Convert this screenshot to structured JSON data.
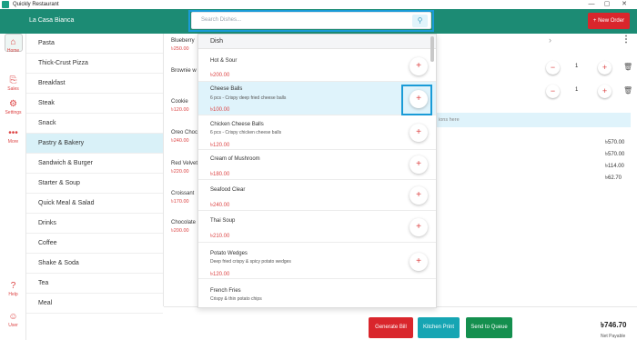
{
  "window": {
    "title": "Quickly Restaurant",
    "controls": [
      "—",
      "▢",
      "✕"
    ]
  },
  "header": {
    "store_name": "La Casa Bianca",
    "search_placeholder": "Search Dishes...",
    "new_order_label": "+ New Order"
  },
  "rail": [
    {
      "label": "Home",
      "icon": "⌂"
    },
    {
      "label": "Sales",
      "icon": "⎘"
    },
    {
      "label": "Settings",
      "icon": "⚙"
    },
    {
      "label": "More",
      "icon": "•••"
    },
    {
      "label": "Help",
      "icon": "?"
    },
    {
      "label": "User",
      "icon": "☺"
    }
  ],
  "categories": [
    "Pasta",
    "Thick-Crust Pizza",
    "Breakfast",
    "Steak",
    "Snack",
    "Pastry & Bakery",
    "Sandwich & Burger",
    "Starter & Soup",
    "Quick Meal & Salad",
    "Drinks",
    "Coffee",
    "Shake & Soda",
    "Tea",
    "Meal"
  ],
  "active_category": "Pastry & Bakery",
  "products": [
    {
      "name": "Blueberry",
      "price": "৳250.00"
    },
    {
      "name": "Brownie w",
      "price": ""
    },
    {
      "name": "Cookie",
      "price": "৳120.00"
    },
    {
      "name": "Oreo Choc",
      "price": "৳240.00"
    },
    {
      "name": "Red Velvet",
      "price": "৳220.00"
    },
    {
      "name": "Croissant",
      "price": "৳170.00"
    },
    {
      "name": "Chocolate",
      "price": "৳200.00"
    }
  ],
  "dropdown": {
    "header": "Dish",
    "items": [
      {
        "name": "Hot & Sour",
        "desc": "",
        "price": "৳200.00"
      },
      {
        "name": "Cheese Balls",
        "desc": "6 pcs - Crispy deep fried cheese balls",
        "price": "৳100.00"
      },
      {
        "name": "Chicken Cheese Balls",
        "desc": "6 pcs - Crispy chicken cheese balls",
        "price": "৳120.00"
      },
      {
        "name": "Cream of Mushroom",
        "desc": "",
        "price": "৳180.00"
      },
      {
        "name": "Seafood Clear",
        "desc": "",
        "price": "৳240.00"
      },
      {
        "name": "Thai Soup",
        "desc": "",
        "price": "৳210.00"
      },
      {
        "name": "Potato Wedges",
        "desc": "Deep fried crispy & spicy potato wedges",
        "price": "৳120.00"
      },
      {
        "name": "French Fries",
        "desc": "Crispy & thin potato chips",
        "price": ""
      }
    ],
    "add_glyph": "+"
  },
  "order": {
    "lines": [
      {
        "qty": "1"
      },
      {
        "qty": "1"
      }
    ],
    "instructions_placeholder": "ions here",
    "totals": [
      "৳570.00",
      "৳570.00",
      "৳114.00",
      "৳62.70"
    ]
  },
  "footer": {
    "generate_bill": "Generate Bill",
    "kitchen_print": "Kitchen Print",
    "send_to_queue": "Send to Queue",
    "net_payable_amount": "৳746.70",
    "net_payable_label": "Net Payable"
  },
  "colors": {
    "brand": "#1c8b74",
    "red": "#d9262c",
    "teal": "#16a5b3",
    "green": "#148f4e",
    "highlight": "#1a9bd7"
  }
}
